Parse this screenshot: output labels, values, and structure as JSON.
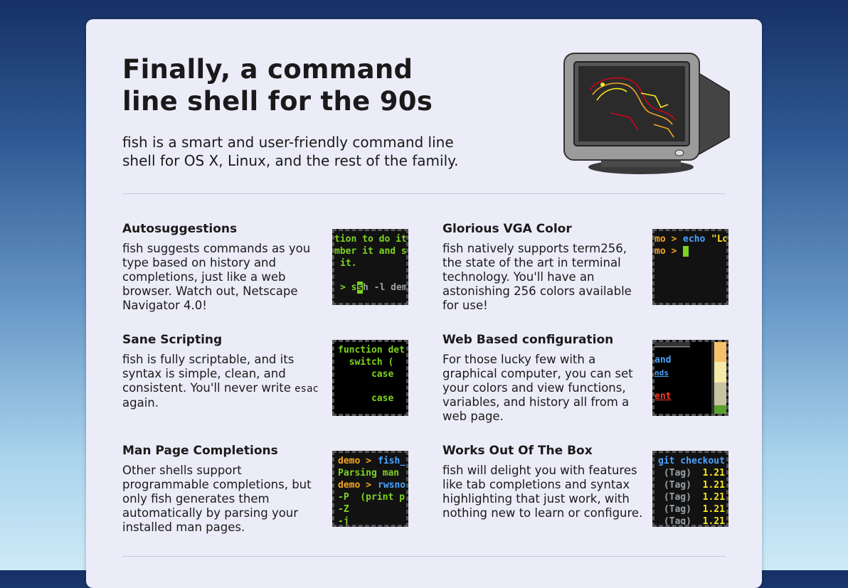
{
  "hero": {
    "headline_line1": "Finally, a command",
    "headline_line2": "line shell for the 90s",
    "tagline_line1": "fish is a smart and user-friendly command line",
    "tagline_line2": "shell for OS X, Linux, and the rest of the family."
  },
  "colors": {
    "green": "#7ed321",
    "blue": "#4aa3ff",
    "orange": "#f5a623",
    "red": "#ff3b30",
    "gray": "#9aa0a6"
  },
  "features": [
    {
      "title": "Autosuggestions",
      "description": "fish suggests commands as you type based on history and completions, just like a web browser. Watch out, Netscape Navigator 4.0!",
      "thumb_lines": [
        "tion to do it",
        "mber it and s",
        "it.",
        "> s",
        "s",
        "h -l dem"
      ]
    },
    {
      "title": "Glorious VGA Color",
      "description": "fish natively supports term256, the state of the art in terminal technology. You'll have an astonishing 256 colors available for use!",
      "thumb_lines": [
        "mo > ",
        "echo ",
        "\"Lo",
        "mo > "
      ]
    },
    {
      "title": "Sane Scripting",
      "description_before": "fish is fully scriptable, and its syntax is simple, clean, and consistent. You'll never write ",
      "description_code": "esac",
      "description_after": " again.",
      "thumb_lines": [
        "function det",
        "  switch (",
        "      case",
        "      case"
      ]
    },
    {
      "title": "Web Based configuration",
      "description": "For those lucky few with a graphical computer, you can set your colors and view functions, variables, and history all from a web page.",
      "thumb_lines": [
        "and",
        "nds",
        "ent"
      ]
    },
    {
      "title": "Man Page Completions",
      "description": "Other shells support programmable completions, but only fish generates them automatically by parsing your installed man pages.",
      "thumb_lines": [
        "demo > ",
        "fish_",
        "Parsing man",
        "demo > ",
        "rwsno",
        "-P  (print p",
        "-Z",
        "-j           ("
      ]
    },
    {
      "title": "Works Out Of The Box",
      "description": "fish will delight you with features like tab completions and syntax highlighting that just work, with nothing new to learn or configure.",
      "thumb_lines": [
        "git checkout",
        " (Tag)  1.21",
        " (Tag)  1.21",
        " (Tag)  1.21",
        " (Tag)  1.21",
        " (Tag)  1.21"
      ]
    }
  ]
}
